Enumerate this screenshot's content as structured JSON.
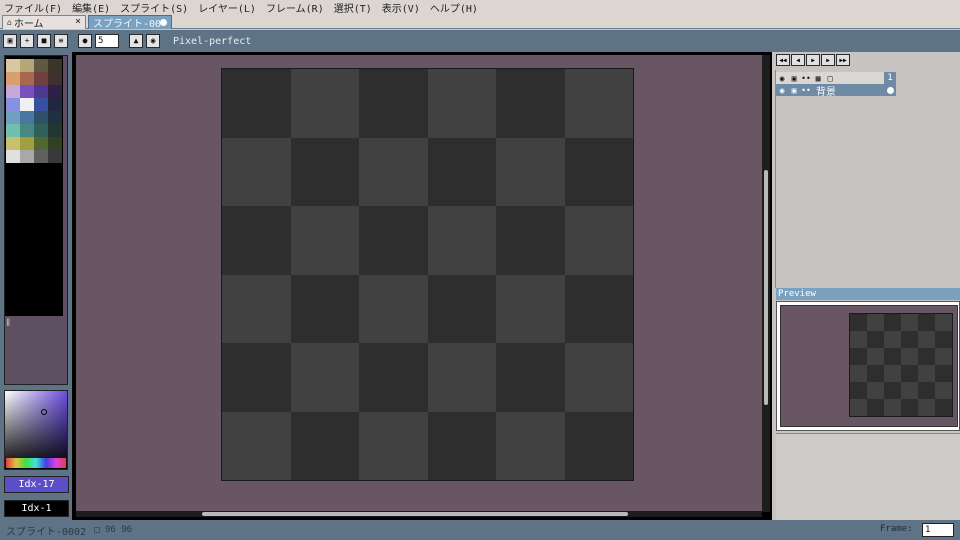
{
  "menu": [
    "ファイル(F)",
    "編集(E)",
    "スプライト(S)",
    "レイヤー(L)",
    "フレーム(R)",
    "選択(T)",
    "表示(V)",
    "ヘルプ(H)"
  ],
  "tabs": {
    "home_label": "ホーム",
    "home_close": "×",
    "sprite_label": "スプライト-00"
  },
  "toolbar": {
    "brush_size": "5",
    "pixel_perfect": "Pixel-perfect"
  },
  "palette": {
    "colors": [
      "#d8c8a0",
      "#b4a878",
      "#605840",
      "#3c3428",
      "#d8a070",
      "#a86850",
      "#704040",
      "#403030",
      "#c8a8d8",
      "#7850c0",
      "#503890",
      "#302048",
      "#8890e0",
      "#f0f0f0",
      "#3850a0",
      "#202840",
      "#70a0c0",
      "#4878a0",
      "#305068",
      "#203040",
      "#70c0b0",
      "#488880",
      "#306058",
      "#203830",
      "#c8c070",
      "#a0a040",
      "#506830",
      "#304020",
      "#e0e0e0",
      "#a8a8a8",
      "#606060",
      "#383838"
    ]
  },
  "color": {
    "fg_label": "Idx-17",
    "bg_label": "Idx-1"
  },
  "layers": {
    "frame_number": "1",
    "background_layer": "背景"
  },
  "preview": {
    "title": "Preview"
  },
  "status": {
    "sprite_name": "スプライト-0002",
    "size": "96 96",
    "frame_label": "Frame:",
    "frame_value": "1"
  }
}
